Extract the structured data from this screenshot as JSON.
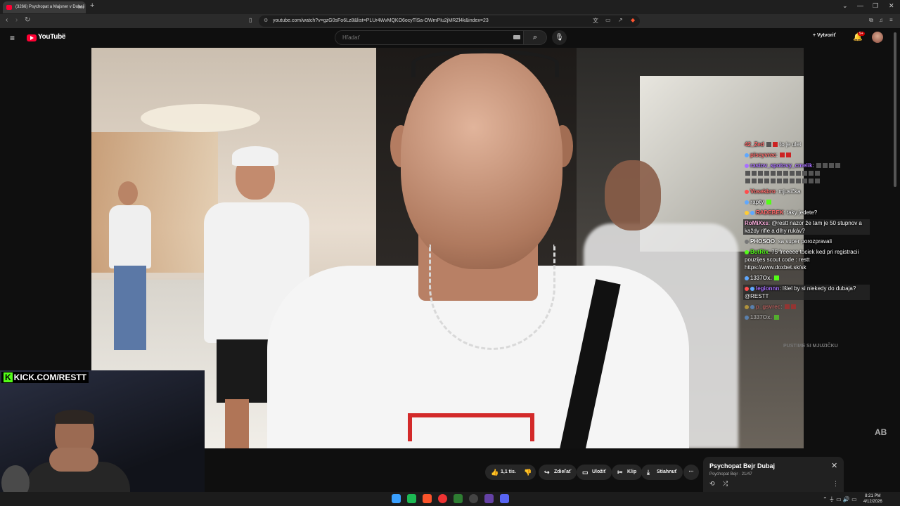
{
  "browser": {
    "tab_title": "(3266) Psychopat a Majsner v Dubaji",
    "new_tab": "+",
    "url": "youtube.com/watch?v=gzG0sFo6Lz8&list=PLUr4WvMQKO6ocyTlSa-OWmPIu2jMRZl4k&index=23",
    "window_controls": [
      "⌄",
      "—",
      "❐",
      "✕"
    ]
  },
  "youtube": {
    "logo": "YouTube",
    "region": "SK",
    "search_placeholder": "Hľadať",
    "create_label": "Vytvoriť",
    "notification_count": "9+"
  },
  "chat": {
    "messages": [
      {
        "user": "42_Zed",
        "text": "to je ulet",
        "color": "#ff4d4d"
      },
      {
        "user": "piscyvrec",
        "text": "",
        "color": "#ff4d4d"
      },
      {
        "user": "rastov_spotovy_cmelik",
        "text": "",
        "color": "#a970ff"
      },
      {
        "user": "Vosekbro",
        "text": "mjusička",
        "color": "#ff4d4d"
      },
      {
        "user": "rapty",
        "text": "",
        "color": "#5fa8ff"
      },
      {
        "user": "RADEBEK",
        "text": "taky jedete?",
        "color": "#ff4d4d"
      },
      {
        "user": "RoMiXxs",
        "text": "@restt nazor že tam je 50 stupnov a každy rifle a dlhy rukáv?",
        "color": "#ff9ad5"
      },
      {
        "user": "PHOSOO",
        "text": "sa super porozpravali",
        "color": "#f1f1f1"
      },
      {
        "user": "BotRix",
        "text": "75 freeeee tociek ked pri registracii pouzijes scout code : restt https://www.doxbet.sk/sk",
        "color": "#53fc18"
      },
      {
        "user": "1337Ox.",
        "text": "",
        "color": "#5fa8ff"
      },
      {
        "user": "legionnn",
        "text": "Išiel by si niekedy do dubaja? @RESTT",
        "color": "#a970ff"
      },
      {
        "user": "p_gsvrec",
        "text": "",
        "color": "#ff4d4d"
      },
      {
        "user": "1337Ox.",
        "text": "",
        "color": "#5fa8ff"
      }
    ],
    "footer": "PUSTIME SI MJUZIČKU"
  },
  "webcam": {
    "label_k": "K",
    "label_text": "KICK.COM/RESTT"
  },
  "actions": {
    "like": "1,1 tis.",
    "share": "Zdieľať",
    "save": "Uložiť",
    "clip": "Klip",
    "download": "Stiahnuť"
  },
  "playlist": {
    "title": "Psychopat Bejr  Dubaj",
    "channel": "Psychopat Bejr",
    "position": "21/47"
  },
  "taskbar": {
    "time": "8:21 PM",
    "date": "4/12/2026"
  },
  "player_watermark": "AB",
  "colors": {
    "youtube_red": "#ff0033",
    "kick_green": "#53fc18",
    "background": "#0f0f0f"
  }
}
